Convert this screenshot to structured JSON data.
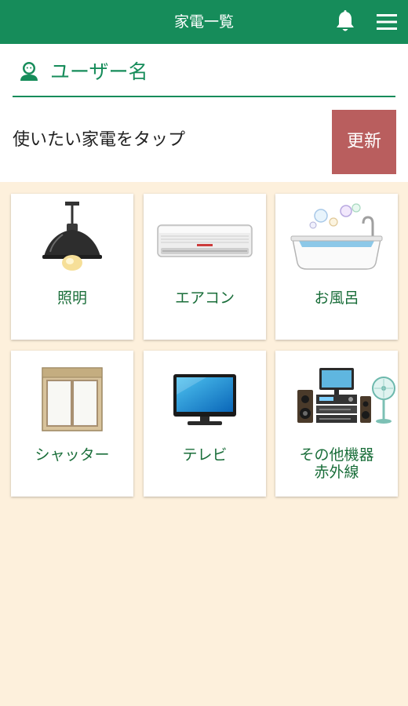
{
  "header": {
    "title": "家電一覧",
    "bell_icon": "bell-icon",
    "menu_icon": "hamburger-menu-icon",
    "background_color": "#168c5a"
  },
  "user": {
    "icon": "user-icon",
    "name": "ユーザー名"
  },
  "instruction": "使いたい家電をタップ",
  "refresh_button": {
    "label": "更新",
    "color": "#b95e5e"
  },
  "appliances": [
    {
      "label": "照明",
      "icon": "pendant-lamp-icon"
    },
    {
      "label": "エアコン",
      "icon": "air-conditioner-icon"
    },
    {
      "label": "お風呂",
      "icon": "bathtub-icon"
    },
    {
      "label": "シャッター",
      "icon": "shutter-window-icon"
    },
    {
      "label": "テレビ",
      "icon": "television-icon"
    },
    {
      "label": "その他機器\n赤外線",
      "icon": "stereo-and-fan-icon"
    }
  ]
}
